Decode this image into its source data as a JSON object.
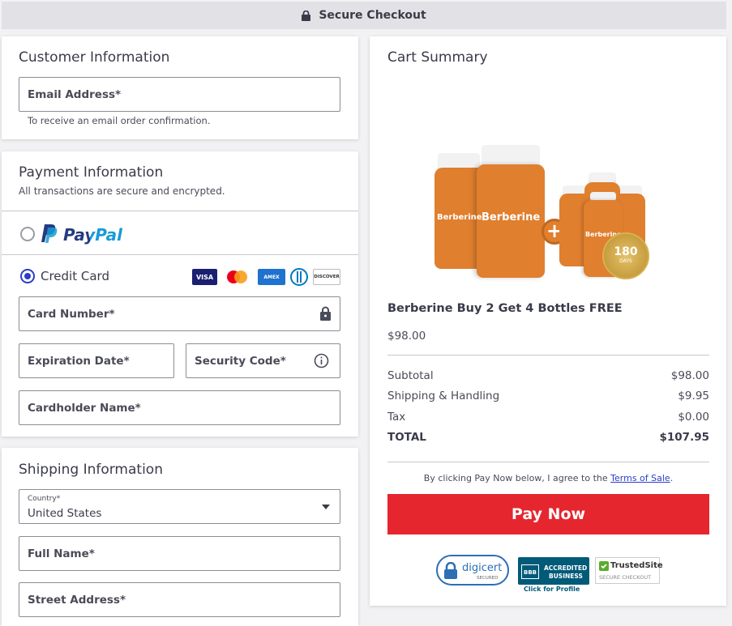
{
  "header": {
    "title": "Secure Checkout"
  },
  "customer": {
    "title": "Customer Information",
    "email_label": "Email Address*",
    "email_hint": "To receive an email order confirmation."
  },
  "payment": {
    "title": "Payment Information",
    "subtitle": "All transactions are secure and encrypted.",
    "paypal_label": "PayPal",
    "credit_label": "Credit Card",
    "card_number": "Card Number*",
    "expiration": "Expiration Date*",
    "security_code": "Security Code*",
    "cardholder": "Cardholder Name*",
    "card_brands": [
      "VISA",
      "AMEX",
      "DISCOVER"
    ],
    "selected_method": "Credit Card"
  },
  "shipping": {
    "title": "Shipping Information",
    "country_label": "Country*",
    "country_value": "United States",
    "full_name": "Full Name*",
    "street": "Street Address*"
  },
  "cart": {
    "title": "Cart Summary",
    "product_name": "Berberine Buy 2 Get 4 Bottles FREE",
    "product_price": "$98.00",
    "bottle_label": "Berberine",
    "badge_number": "180",
    "badge_text": "DAYS",
    "rows": [
      {
        "label": "Subtotal",
        "value": "$98.00"
      },
      {
        "label": "Shipping & Handling",
        "value": "$9.95"
      },
      {
        "label": "Tax",
        "value": "$0.00"
      }
    ],
    "total_label": "TOTAL",
    "total_value": "$107.95",
    "agree_prefix": "By clicking Pay Now below, I agree to the ",
    "terms_link": "Terms of Sale",
    "agree_suffix": ".",
    "pay_button": "Pay Now"
  },
  "trust": {
    "digicert": "digicert",
    "digicert_sub": "SECURED",
    "bbb_top": "ACCREDITED",
    "bbb_bottom": "BUSINESS",
    "bbb_mark": "BBB",
    "bbb_link": "Click for Profile",
    "trusted": "TrustedSite",
    "trusted_sub": "SECURE CHECKOUT"
  },
  "colors": {
    "accent": "#2a3ec8",
    "pay_button": "#e5262f",
    "bottle": "#e07f2e",
    "paypal_dark": "#253b80",
    "paypal_light": "#179bd7"
  }
}
